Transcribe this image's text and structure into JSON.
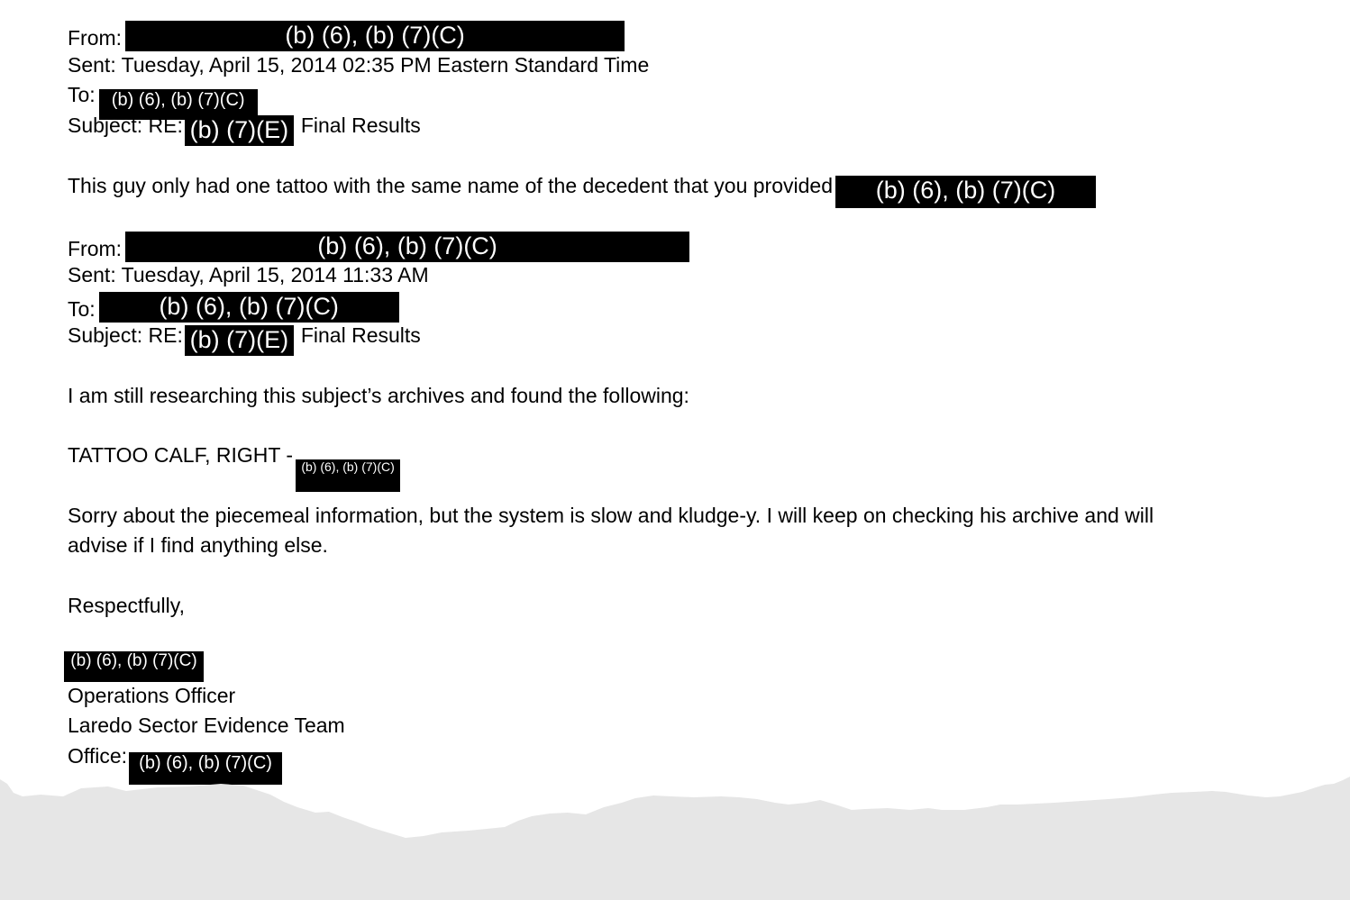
{
  "email1": {
    "from_label": "From:",
    "from_redaction": "(b) (6), (b) (7)(C)",
    "sent": "Sent: Tuesday, April 15, 2014 02:35 PM Eastern Standard Time",
    "to_label": "To:",
    "to_redaction": "(b) (6), (b) (7)(C)",
    "subject_label": "Subject: RE:",
    "subject_redaction": "(b) (7)(E)",
    "subject_rest": "Final Results",
    "body": "This guy only had one tattoo with the same name of the decedent that you provided",
    "body_redaction": "(b) (6), (b) (7)(C)"
  },
  "email2": {
    "from_label": "From:",
    "from_redaction": "(b) (6), (b) (7)(C)",
    "sent": "Sent: Tuesday, April 15, 2014 11:33 AM",
    "to_label": "To:",
    "to_redaction": "(b) (6), (b) (7)(C)",
    "subject_label": "Subject: RE:",
    "subject_redaction": "(b) (7)(E)",
    "subject_rest": "Final Results",
    "body1": "I am still researching this subject’s archives and found the following:",
    "tattoo_label": "TATTOO CALF, RIGHT -",
    "tattoo_redaction": "(b) (6), (b) (7)(C)",
    "body2a": "Sorry about the piecemeal information, but the system is slow and kludge-y.  I will keep on checking his archive and will",
    "body2b": "advise if I find anything else.",
    "closing": "Respectfully,",
    "sig_redaction": "(b) (6), (b) (7)(C)",
    "sig_title": "Operations Officer",
    "sig_team": "Laredo Sector Evidence Team",
    "office_label": "Office:",
    "office_redaction": "(b) (6), (b) (7)(C)"
  }
}
